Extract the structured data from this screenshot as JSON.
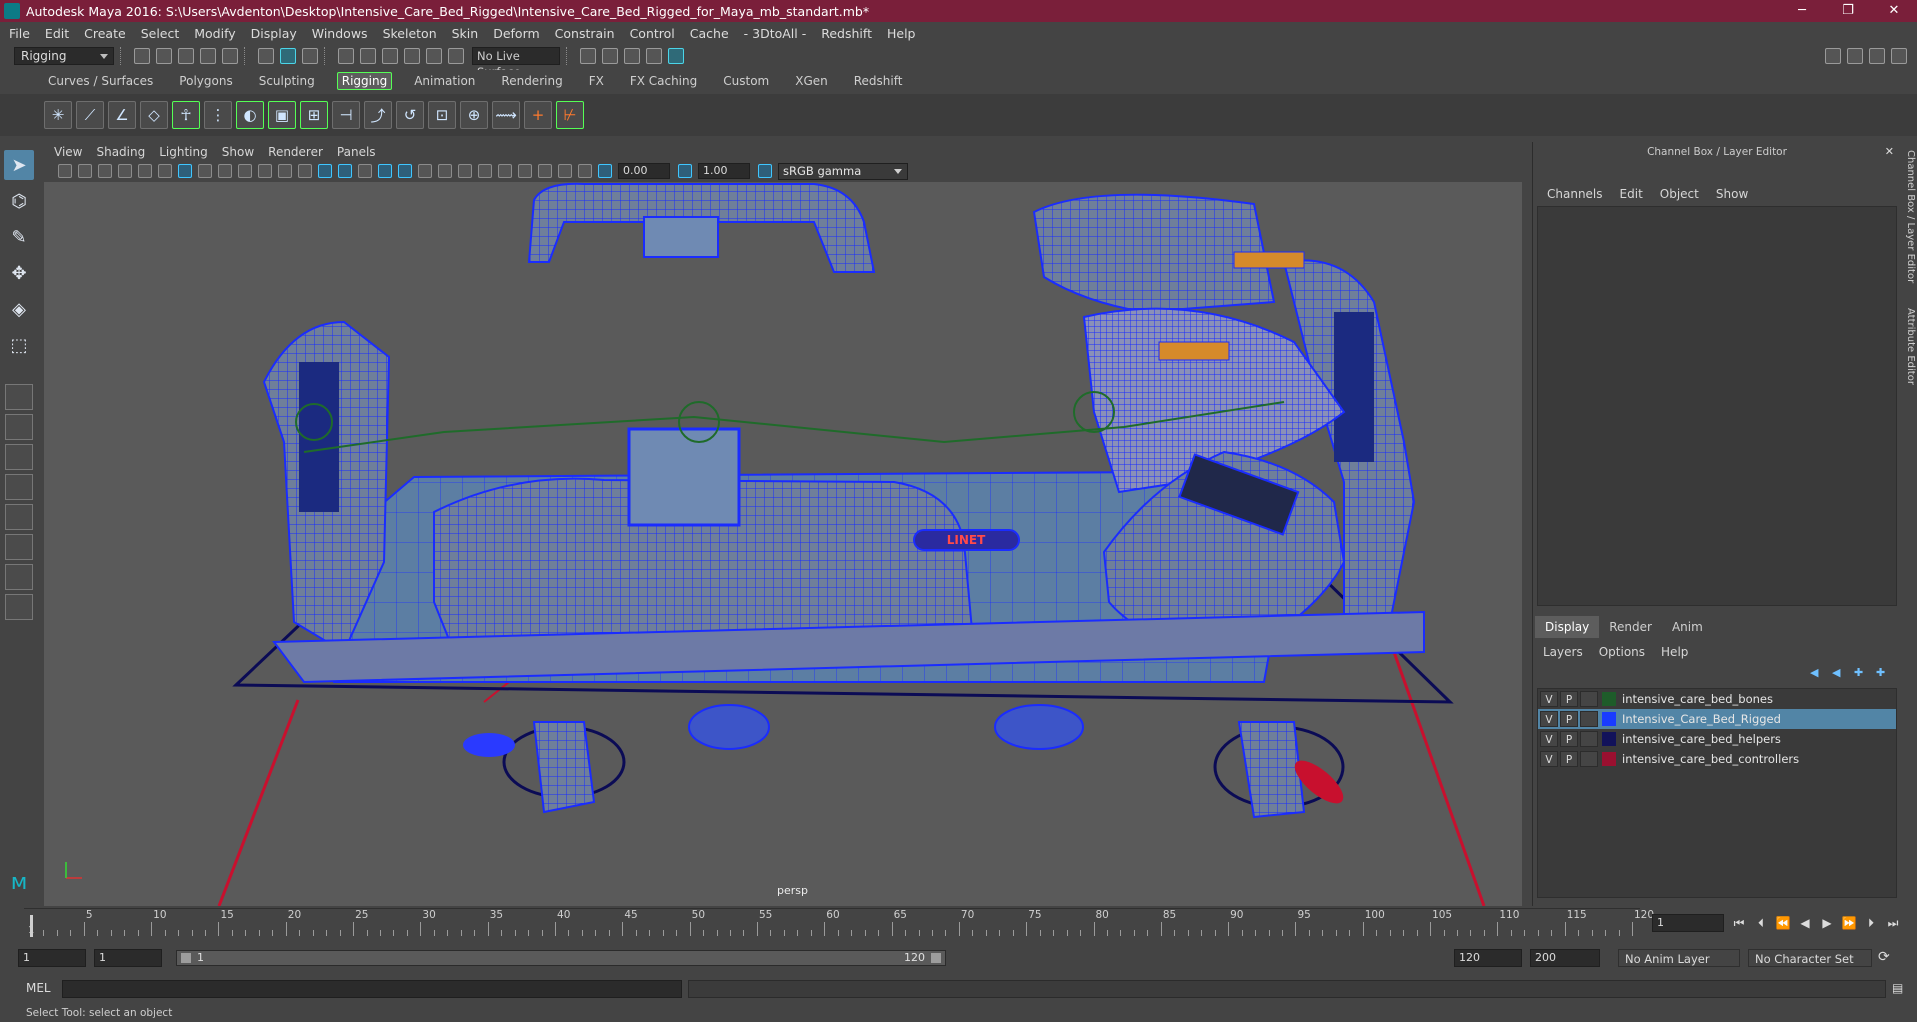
{
  "window": {
    "title": "Autodesk Maya 2016: S:\\Users\\Avdenton\\Desktop\\Intensive_Care_Bed_Rigged\\Intensive_Care_Bed_Rigged_for_Maya_mb_standart.mb*",
    "minimize": "─",
    "maximize": "❐",
    "close": "✕"
  },
  "menubar": [
    "File",
    "Edit",
    "Create",
    "Select",
    "Modify",
    "Display",
    "Windows",
    "Skeleton",
    "Skin",
    "Deform",
    "Constrain",
    "Control",
    "Cache",
    "- 3DtoAll -",
    "Redshift",
    "Help"
  ],
  "statusline": {
    "mode": "Rigging",
    "live_surface": "No Live Surface"
  },
  "shelf": {
    "tabs": [
      "Curves / Surfaces",
      "Polygons",
      "Sculpting",
      "Rigging",
      "Animation",
      "Rendering",
      "FX",
      "FX Caching",
      "Custom",
      "XGen",
      "Redshift"
    ],
    "active_tab": "Rigging"
  },
  "viewport": {
    "menu": [
      "View",
      "Shading",
      "Lighting",
      "Show",
      "Renderer",
      "Panels"
    ],
    "exposure": "0.00",
    "gamma": "1.00",
    "color_space": "sRGB gamma",
    "camera_label": "persp",
    "brand_label": "LINET"
  },
  "channel_box": {
    "title": "Channel Box / Layer Editor",
    "menu": [
      "Channels",
      "Edit",
      "Object",
      "Show"
    ],
    "side_tabs": [
      "Channel Box / Layer Editor",
      "Attribute Editor"
    ]
  },
  "layer_editor": {
    "tabs": [
      "Display",
      "Render",
      "Anim"
    ],
    "active_tab": "Display",
    "menu": [
      "Layers",
      "Options",
      "Help"
    ],
    "layers": [
      {
        "v": "V",
        "p": "P",
        "name": "intensive_care_bed_bones",
        "color": "#1e5c2a",
        "selected": false
      },
      {
        "v": "V",
        "p": "P",
        "name": "Intensive_Care_Bed_Rigged",
        "color": "#1a3cff",
        "selected": true
      },
      {
        "v": "V",
        "p": "P",
        "name": "intensive_care_bed_helpers",
        "color": "#12125a",
        "selected": false
      },
      {
        "v": "V",
        "p": "P",
        "name": "intensive_care_bed_controllers",
        "color": "#9a1030",
        "selected": false
      }
    ]
  },
  "timeline": {
    "labels": [
      "5",
      "10",
      "15",
      "20",
      "25",
      "30",
      "35",
      "40",
      "45",
      "50",
      "55",
      "60",
      "65",
      "70",
      "75",
      "80",
      "85",
      "90",
      "95",
      "100",
      "105",
      "110",
      "115",
      "120"
    ],
    "current_frame_label": "1",
    "current_frame": "1"
  },
  "range": {
    "start": "1",
    "playback_start": "1",
    "slider_start": "1",
    "slider_end": "120",
    "playback_end": "120",
    "end": "200",
    "anim_layer": "No Anim Layer",
    "character_set": "No Character Set"
  },
  "command": {
    "language": "MEL",
    "help": "Select Tool: select an object"
  },
  "colors": {
    "title_bar": "#7a1f3a",
    "wire": "#1a2cff",
    "selection": "#5285a6",
    "active_outline": "#55ff55"
  }
}
